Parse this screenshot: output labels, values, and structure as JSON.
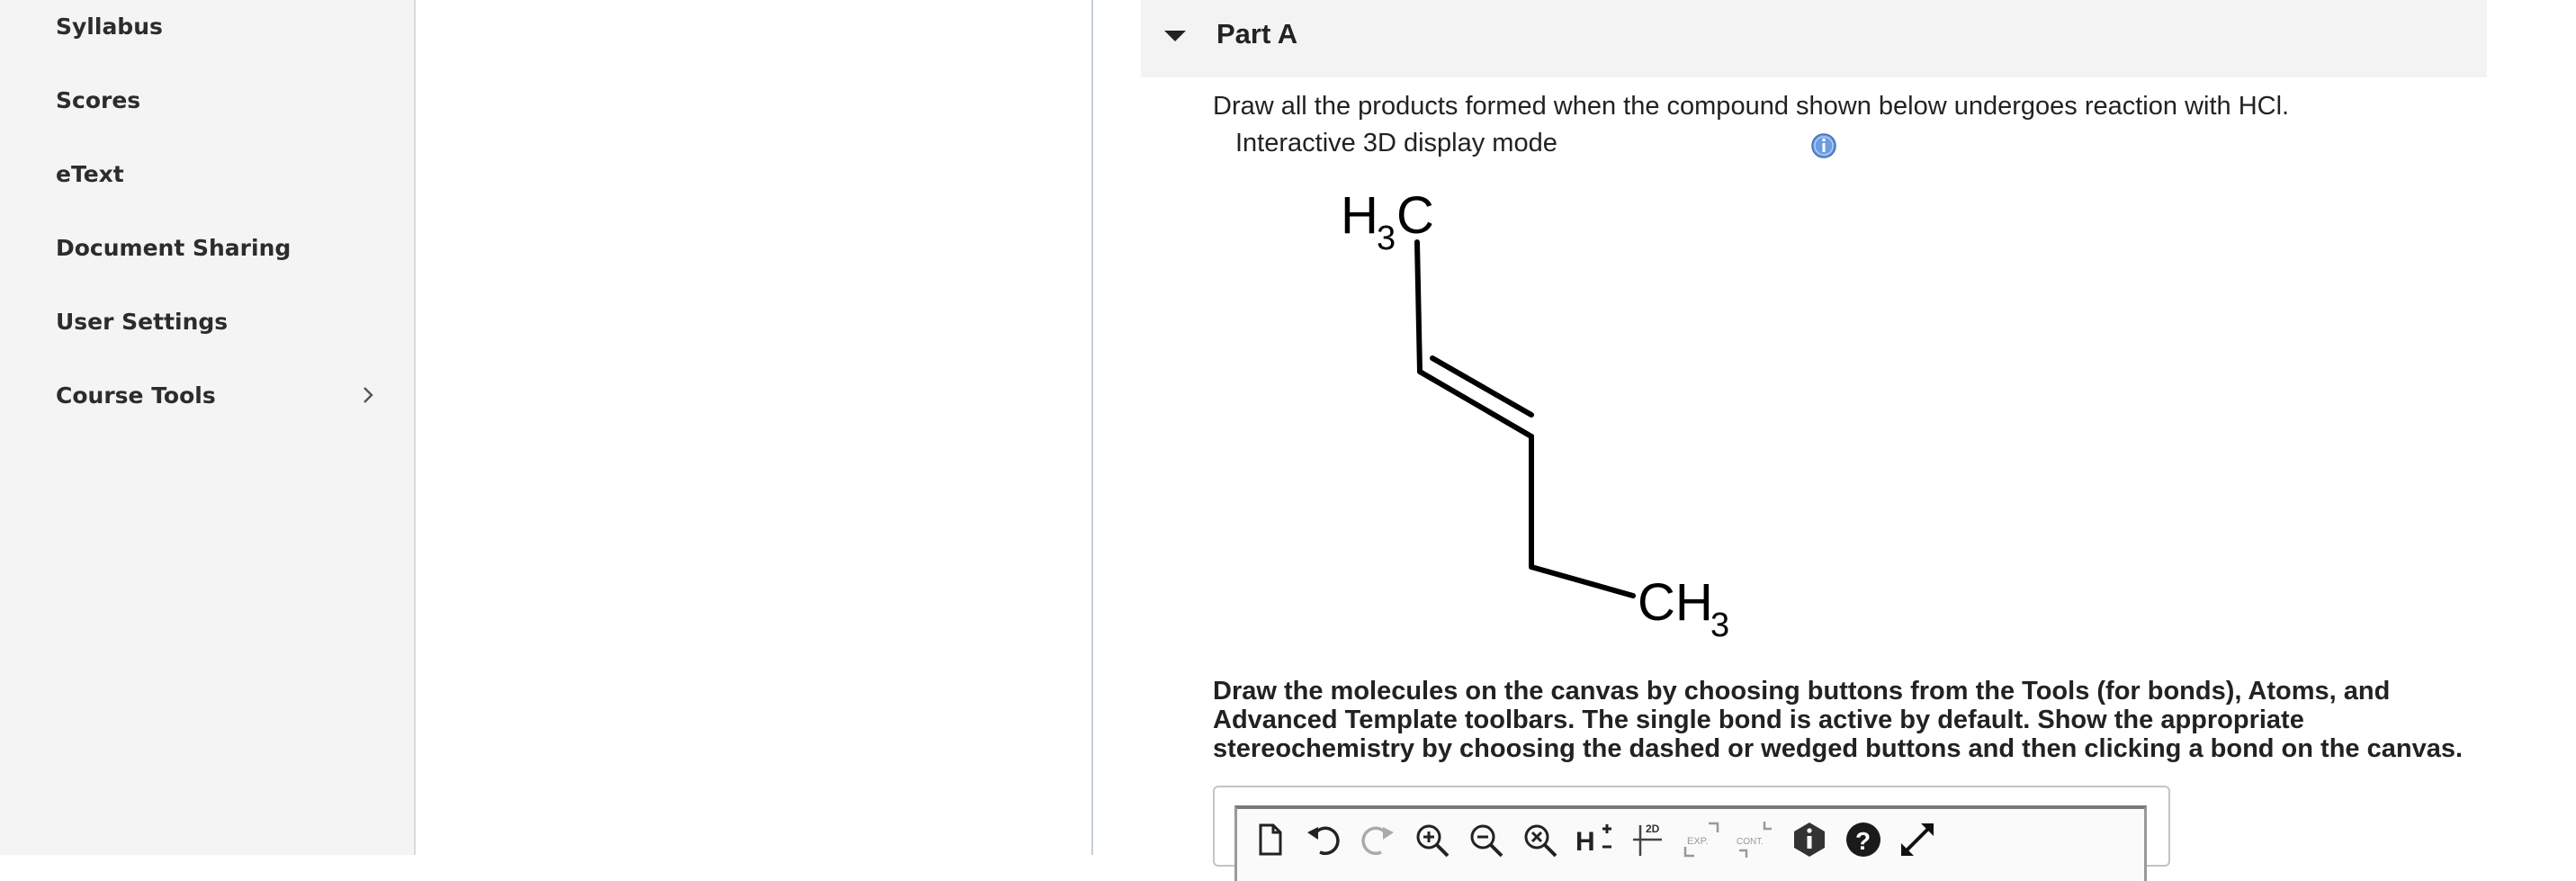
{
  "sidebar": {
    "items": [
      {
        "label": "Syllabus"
      },
      {
        "label": "Scores"
      },
      {
        "label": "eText"
      },
      {
        "label": "Document Sharing"
      },
      {
        "label": "User Settings"
      },
      {
        "label": "Course Tools",
        "icon": "chevron-right-icon"
      }
    ]
  },
  "part": {
    "title": "Part A",
    "toggle_icon": "caret-down-icon"
  },
  "question": {
    "prompt": "Draw all the products formed when the compound shown below undergoes reaction with HCl.",
    "display_mode": "Interactive 3D display mode",
    "info_icon": "info-icon"
  },
  "molecule": {
    "label_top": {
      "main": "H",
      "sub": "3",
      "tail": "C"
    },
    "label_bottom": {
      "main": "CH",
      "sub": "3"
    }
  },
  "instructions": "Draw the molecules on the canvas by choosing buttons from the Tools (for bonds), Atoms, and Advanced Template toolbars. The single bond is active by default. Show the appropriate stereochemistry by choosing the dashed or wedged buttons and then clicking a bond on the canvas.",
  "toolbar": {
    "tools": [
      "new-document-icon",
      "undo-icon",
      "redo-icon",
      "zoom-in-icon",
      "zoom-out-icon",
      "zoom-reset-icon",
      "explicit-hydrogens-icon",
      "clean-2d-icon",
      "expand-icon",
      "contract-icon",
      "about-icon",
      "help-icon",
      "fullscreen-icon"
    ],
    "labels": {
      "clean_2d": "2D",
      "expand": "EXP.",
      "contract": "CONT."
    }
  },
  "colors": {
    "sidebar_bg": "#f4f4f4",
    "header_bg": "#f3f3f3",
    "info_blue": "#5b8fd6"
  }
}
